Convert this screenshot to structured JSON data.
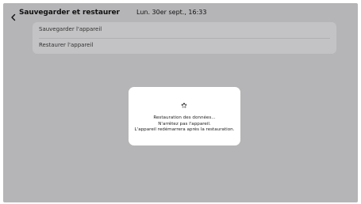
{
  "header": {
    "title": "Sauvegarder et restaurer",
    "back_icon": "chevron-left-icon",
    "datetime": "Lun. 30er sept., 16:33"
  },
  "settings": {
    "items": [
      {
        "label": "Sauvegarder l'appareil"
      },
      {
        "label": "Restaurer l'appareil"
      }
    ]
  },
  "dialog": {
    "icon": "spinner-icon",
    "lines": [
      "Restauration des données...",
      "N'arrêtez pas l'appareil.",
      "L'appareil redémarrera après la restauration."
    ]
  },
  "colors": {
    "background": "#b5b5b7",
    "card": "#c3c3c5",
    "dialog": "#ffffff"
  }
}
